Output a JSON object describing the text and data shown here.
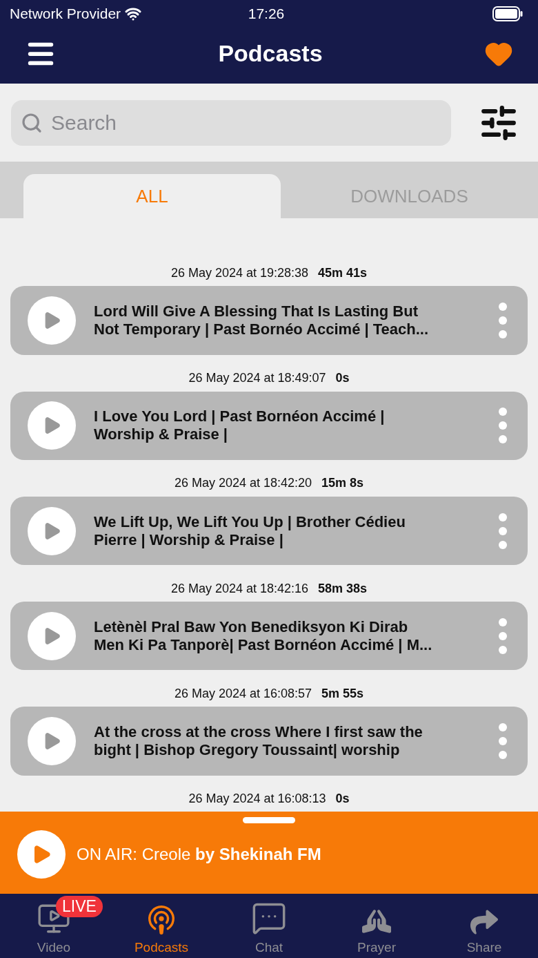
{
  "status_bar": {
    "carrier": "Network Provider",
    "time": "17:26"
  },
  "nav_bar": {
    "title": "Podcasts"
  },
  "search": {
    "placeholder": "Search"
  },
  "tabs": [
    {
      "label": "ALL",
      "selected": true
    },
    {
      "label": "DOWNLOADS",
      "selected": false
    }
  ],
  "episodes": [
    {
      "date": "26 May 2024 at 19:28:38",
      "duration": "45m 41s",
      "title": "Lord Will Give A Blessing That Is Lasting But Not Temporary | Past Bornéo Accimé | Teach..."
    },
    {
      "date": "26 May 2024 at 18:49:07",
      "duration": "0s",
      "title": "I Love You Lord | Past Bornéon Accimé | Worship & Praise |"
    },
    {
      "date": "26 May 2024 at 18:42:20",
      "duration": "15m 8s",
      "title": "We Lift Up, We Lift You Up | Brother Cédieu Pierre | Worship & Praise |"
    },
    {
      "date": "26 May 2024 at 18:42:16",
      "duration": "58m 38s",
      "title": "Letènèl  Pral Baw Yon Benediksyon Ki Dirab Men Ki Pa Tanporè| Past Bornéon Accimé | M..."
    },
    {
      "date": "26 May 2024 at 16:08:57",
      "duration": "5m 55s",
      "title": "At the cross at the cross Where I first saw the bight  | Bishop Gregory Toussaint| worship"
    },
    {
      "date": "26 May 2024 at 16:08:13",
      "duration": "0s"
    }
  ],
  "player": {
    "text": "ON AIR: Creole **by Shekinah FM**"
  },
  "tab_bar": [
    {
      "label": "Video",
      "selected": false,
      "badge": "LIVE"
    },
    {
      "label": "Podcasts",
      "selected": true
    },
    {
      "label": "Chat",
      "selected": false
    },
    {
      "label": "Prayer",
      "selected": false
    },
    {
      "label": "Share",
      "selected": false
    }
  ]
}
